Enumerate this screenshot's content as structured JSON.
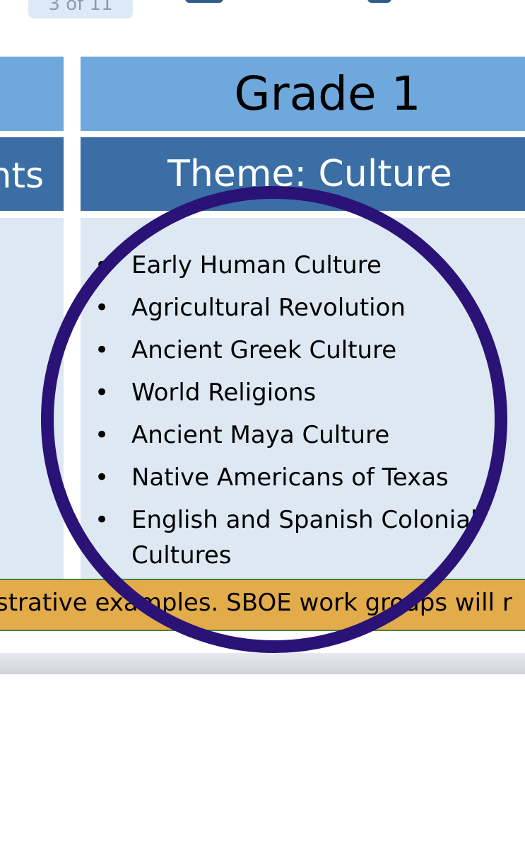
{
  "header": {
    "page_badge": "3 of 11"
  },
  "left_column": {
    "theme_fragment": "nts"
  },
  "grade": {
    "title": "Grade 1",
    "theme": "Theme: Culture",
    "items": [
      "Early Human Culture",
      "Agricultural Revolution",
      "Ancient Greek Culture",
      "World Religions",
      "Ancient Maya Culture",
      "Native Americans of Texas",
      "English and Spanish Colonial Cultures"
    ]
  },
  "footer": {
    "note": "strative examples. SBOE work groups will r"
  },
  "colors": {
    "header_light_blue": "#6fa8dc",
    "header_dark_blue": "#3a6ea5",
    "content_bg": "#dde8f3",
    "footer_gold": "#e3ac4a",
    "circle_annotation": "#2a1277"
  }
}
